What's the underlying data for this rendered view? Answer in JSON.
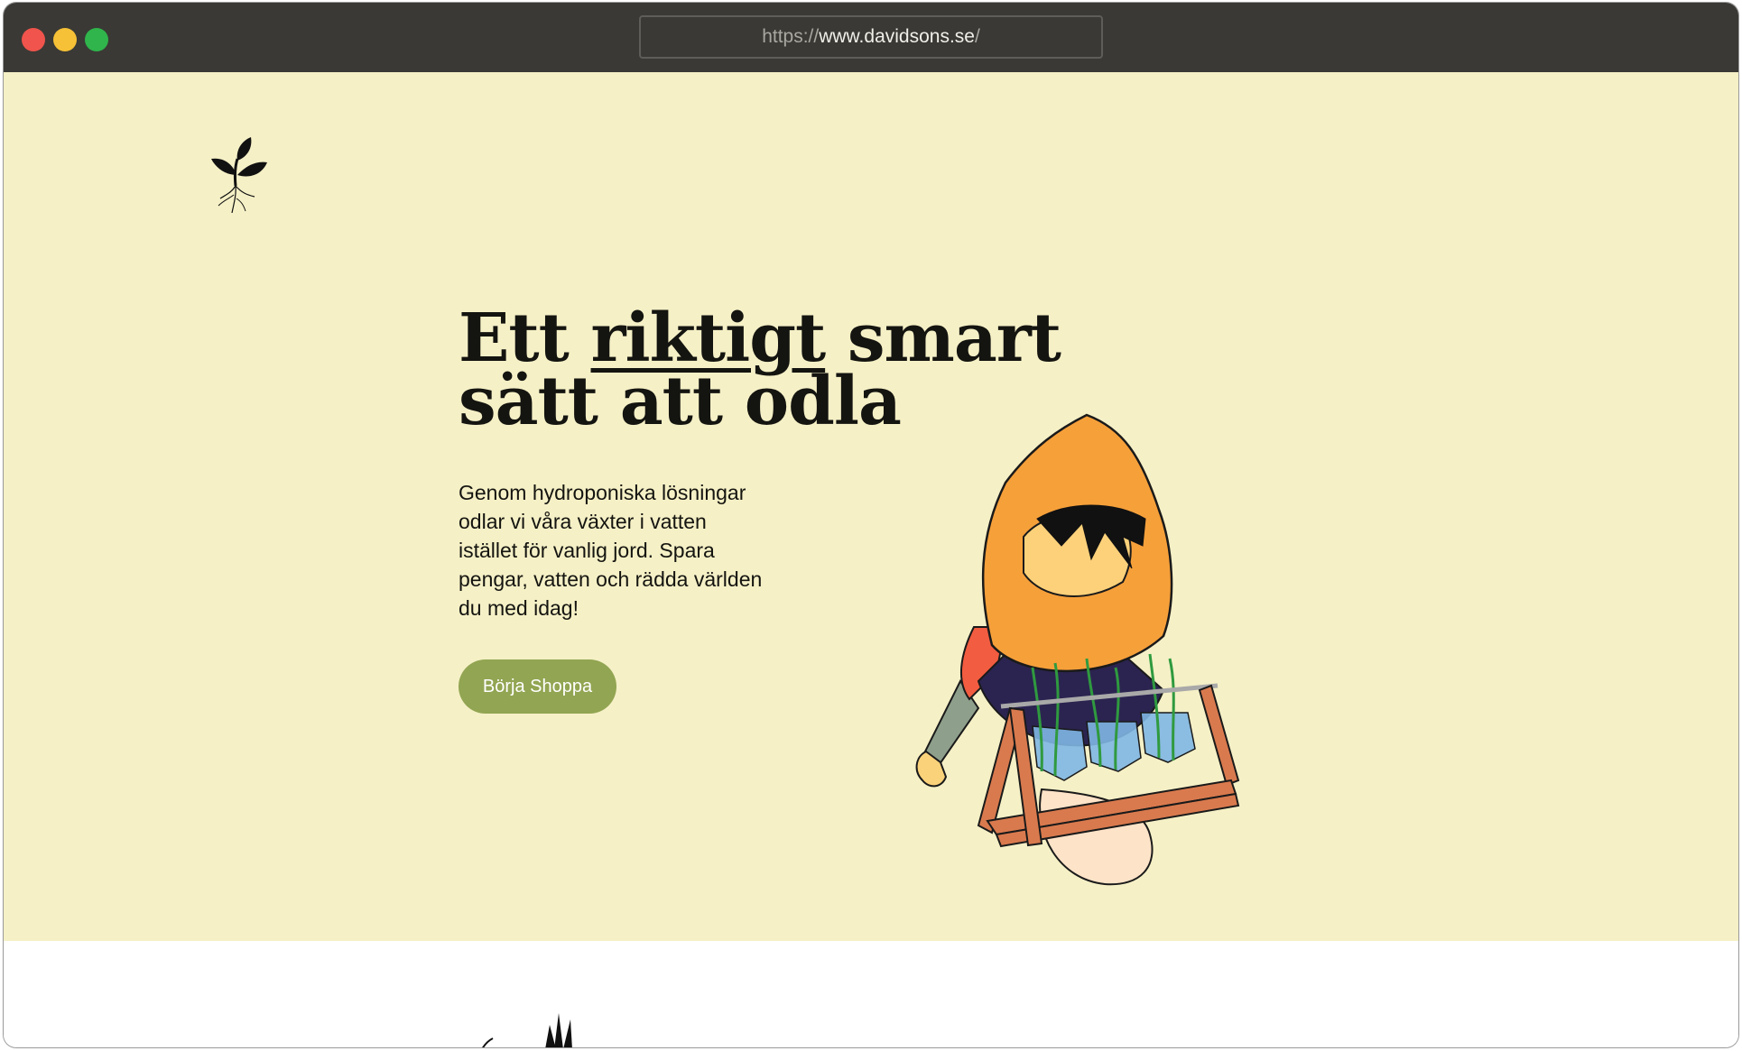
{
  "browser": {
    "url_protocol": "https://",
    "url_host": "www.davidsons.se",
    "url_trail": "/"
  },
  "hero": {
    "headline_part1": "Ett ",
    "headline_emphasis": "riktigt",
    "headline_part2": " smart",
    "headline_line2": "sätt att odla",
    "lede": "Genom hydroponiska lösningar odlar vi våra växter i vatten istället för vanlig jord. Spara pengar, vatten och rädda världen du med idag!",
    "cta_label": "Börja Shoppa",
    "cta_color": "#92a552",
    "background": "#f5f0c6"
  },
  "icons": {
    "logo": "sprout-logo-icon",
    "illustration": "gardener-carrying-hydroponic-jars-illustration",
    "below": "plant-silhouette-icon"
  }
}
